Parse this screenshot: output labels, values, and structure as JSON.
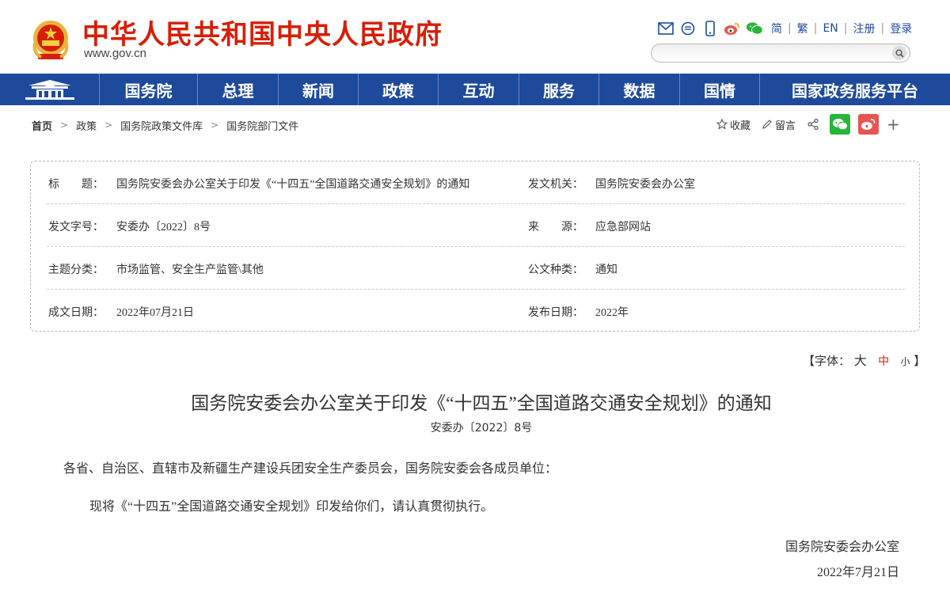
{
  "header": {
    "site_name": "中华人民共和国中央人民政府",
    "site_url": "www.gov.cn",
    "links": [
      "简",
      "繁",
      "EN",
      "注册",
      "登录"
    ],
    "icons": [
      "mail-icon",
      "message-icon",
      "mobile-icon",
      "weibo-icon",
      "wechat-icon"
    ],
    "search_placeholder": ""
  },
  "nav": {
    "items": [
      "国务院",
      "总理",
      "新闻",
      "政策",
      "互动",
      "服务",
      "数据",
      "国情",
      "国家政务服务平台"
    ]
  },
  "breadcrumb": [
    "首页",
    "政策",
    "国务院政策文件库",
    "国务院部门文件"
  ],
  "tools": {
    "favorite": "收藏",
    "comment": "留言"
  },
  "info": {
    "rows": [
      {
        "label1": "标　　题：",
        "value1": "国务院安委会办公室关于印发《“十四五”全国道路交通安全规划》的通知",
        "label2": "发文机关：",
        "value2": "国务院安委会办公室"
      },
      {
        "label1": "发文字号：",
        "value1": "安委办〔2022〕8号",
        "label2": "来　　源：",
        "value2": "应急部网站"
      },
      {
        "label1": "主题分类：",
        "value1": "市场监管、安全生产监管\\其他",
        "label2": "公文种类：",
        "value2": "通知"
      },
      {
        "label1": "成文日期：",
        "value1": "2022年07月21日",
        "label2": "发布日期：",
        "value2": "2022年"
      }
    ]
  },
  "font_size": {
    "open": "【字体：",
    "big": "大",
    "mid": "中",
    "small": "小",
    "close": "】"
  },
  "article": {
    "title": "国务院安委会办公室关于印发《“十四五”全国道路交通安全规划》的通知",
    "doc_number": "安委办〔2022〕8号",
    "paragraphs": [
      "各省、自治区、直辖市及新疆生产建设兵团安全生产委员会，国务院安委会各成员单位：",
      "现将《“十四五”全国道路交通安全规划》印发给你们，请认真贯彻执行。"
    ],
    "signature_org": "国务院安委会办公室",
    "signature_date": "2022年7月21日"
  },
  "colors": {
    "brand_red": "#d81e06",
    "nav_blue": "#1e4a9c",
    "wechat_green": "#27b53a",
    "weibo_red": "#e8554e"
  }
}
